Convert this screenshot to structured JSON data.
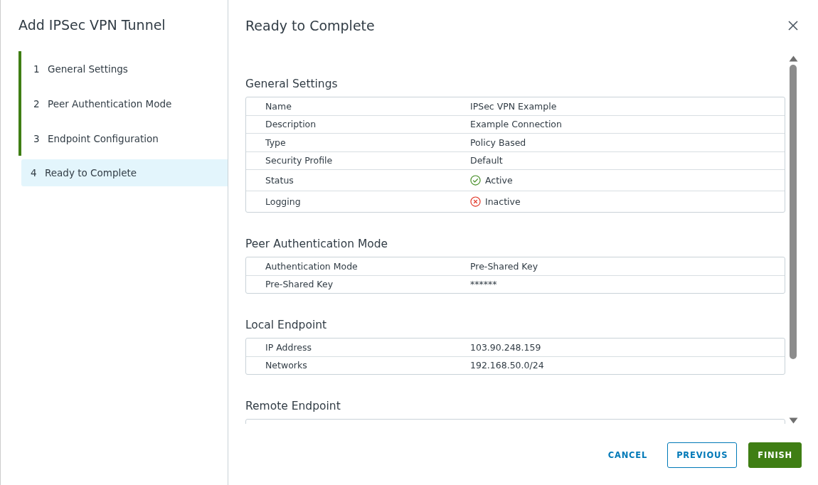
{
  "wizard": {
    "title": "Add IPSec VPN Tunnel",
    "steps": [
      {
        "number": "1",
        "label": "General Settings",
        "completed": true,
        "selected": false
      },
      {
        "number": "2",
        "label": "Peer Authentication Mode",
        "completed": true,
        "selected": false
      },
      {
        "number": "3",
        "label": "Endpoint Configuration",
        "completed": true,
        "selected": false
      },
      {
        "number": "4",
        "label": "Ready to Complete",
        "completed": false,
        "selected": true
      }
    ]
  },
  "page": {
    "title": "Ready to Complete",
    "sections": [
      {
        "title": "General Settings",
        "rows": [
          {
            "label": "Name",
            "value": "IPSec VPN Example",
            "kind": "text"
          },
          {
            "label": "Description",
            "value": "Example Connection",
            "kind": "text"
          },
          {
            "label": "Type",
            "value": "Policy Based",
            "kind": "text"
          },
          {
            "label": "Security Profile",
            "value": "Default",
            "kind": "text"
          },
          {
            "label": "Status",
            "value": "Active",
            "kind": "ok"
          },
          {
            "label": "Logging",
            "value": "Inactive",
            "kind": "error"
          }
        ]
      },
      {
        "title": "Peer Authentication Mode",
        "rows": [
          {
            "label": "Authentication Mode",
            "value": "Pre-Shared Key",
            "kind": "text"
          },
          {
            "label": "Pre-Shared Key",
            "value": "******",
            "kind": "text"
          }
        ]
      },
      {
        "title": "Local Endpoint",
        "rows": [
          {
            "label": "IP Address",
            "value": "103.90.248.159",
            "kind": "text"
          },
          {
            "label": "Networks",
            "value": "192.168.50.0/24",
            "kind": "text"
          }
        ]
      },
      {
        "title": "Remote Endpoint"
      }
    ]
  },
  "buttons": [
    {
      "label": "CANCEL",
      "kind": "flat"
    },
    {
      "label": "PREVIOUS",
      "kind": "outline"
    },
    {
      "label": "FINISH",
      "kind": "primary"
    }
  ]
}
